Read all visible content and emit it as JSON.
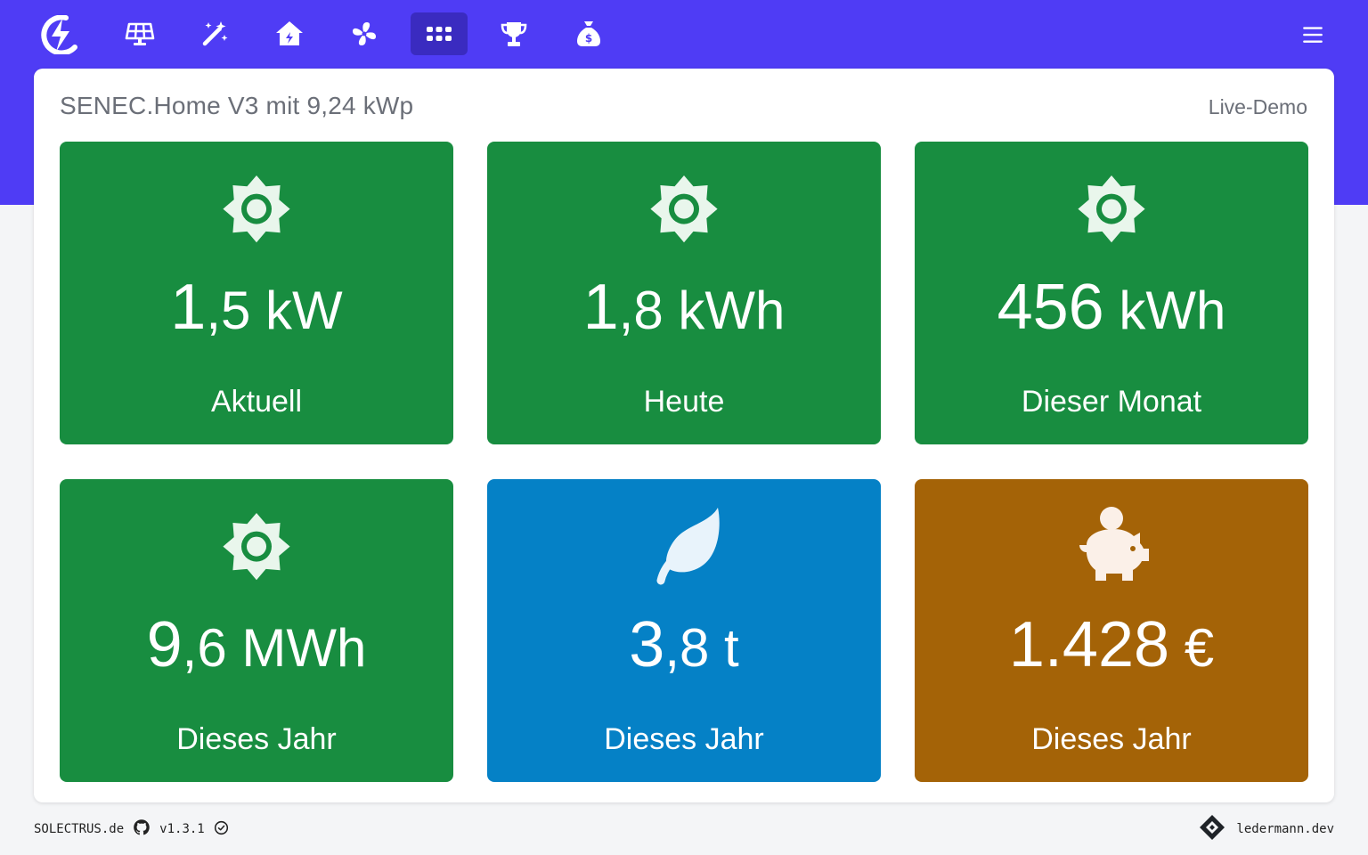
{
  "colors": {
    "brand": "#4f3cf5",
    "nav_active": "#3a2bc0",
    "tile_green": "#188d40",
    "tile_blue": "#0581c6",
    "tile_brown": "#a46307",
    "icon_tint": "#e9f6ec"
  },
  "navbar": {
    "items": [
      {
        "icon": "lightning-logo-icon"
      },
      {
        "icon": "solar-panel-icon"
      },
      {
        "icon": "magic-wand-icon"
      },
      {
        "icon": "house-icon"
      },
      {
        "icon": "fan-icon"
      },
      {
        "icon": "grid-dots-icon",
        "active": true
      },
      {
        "icon": "trophy-icon"
      },
      {
        "icon": "money-bag-icon"
      }
    ],
    "menu_icon": "hamburger-icon"
  },
  "card": {
    "title": "SENEC.Home V3 mit 9,24 kWp",
    "subtitle": "Live-Demo"
  },
  "tiles": [
    {
      "icon": "sun-icon",
      "number": "1",
      "rest": ",5 kW",
      "label": "Aktuell",
      "color": "green"
    },
    {
      "icon": "sun-icon",
      "number": "1",
      "rest": ",8 kWh",
      "label": "Heute",
      "color": "green"
    },
    {
      "icon": "sun-icon",
      "number": "456",
      "rest": " kWh",
      "label": "Dieser Monat",
      "color": "green"
    },
    {
      "icon": "sun-icon",
      "number": "9",
      "rest": ",6 MWh",
      "label": "Dieses Jahr",
      "color": "green"
    },
    {
      "icon": "leaf-icon",
      "number": "3",
      "rest": ",8 t",
      "label": "Dieses Jahr",
      "color": "blue"
    },
    {
      "icon": "piggy-bank-icon",
      "number": "1.428",
      "rest": " €",
      "label": "Dieses Jahr",
      "color": "brown"
    }
  ],
  "footer": {
    "site": "SOLECTRUS.de",
    "version": "v1.3.1",
    "author": "ledermann.dev"
  }
}
